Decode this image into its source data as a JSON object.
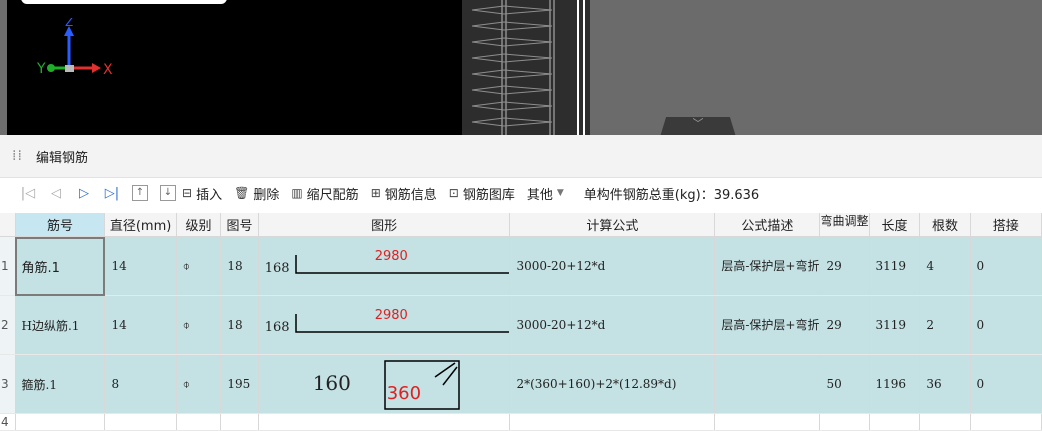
{
  "viewport": {
    "axis": {
      "z": "Z",
      "y": "Y",
      "x": "X"
    },
    "handle_glyph": "﹀"
  },
  "panel": {
    "title": "编辑钢筋",
    "grip_glyph": "⁞⁞"
  },
  "toolbar": {
    "nav_first": "|◁",
    "nav_prev": "◁",
    "nav_next": "▷",
    "nav_last": "▷|",
    "move_up": "↑",
    "move_down": "↓",
    "insert": "插入",
    "delete": "删除",
    "scale": "缩尺配筋",
    "info": "钢筋信息",
    "library": "钢筋图库",
    "other": "其他",
    "total_label": "单构件钢筋总重(kg)：39.636"
  },
  "columns": [
    "筋号",
    "直径(mm)",
    "级别",
    "图号",
    "图形",
    "计算公式",
    "公式描述",
    "弯曲调整",
    "长度",
    "根数",
    "搭接"
  ],
  "rows": [
    {
      "num": "1",
      "name": "角筋.1",
      "dia": "14",
      "grade": "⌽",
      "fig": "18",
      "shape_left": "168",
      "shape_top": "2980",
      "shape_type": "L",
      "formula": "3000-20+12*d",
      "desc": "层高-保护层+弯折",
      "bend": "29",
      "length": "3119",
      "count": "4",
      "lap": "0"
    },
    {
      "num": "2",
      "name": "H边纵筋.1",
      "dia": "14",
      "grade": "⌽",
      "fig": "18",
      "shape_left": "168",
      "shape_top": "2980",
      "shape_type": "L",
      "formula": "3000-20+12*d",
      "desc": "层高-保护层+弯折",
      "bend": "29",
      "length": "3119",
      "count": "2",
      "lap": "0"
    },
    {
      "num": "3",
      "name": "箍筋.1",
      "dia": "8",
      "grade": "⌽",
      "fig": "195",
      "shape_left": "160",
      "shape_top": "360",
      "shape_type": "stirrup",
      "formula": "2*(360+160)+2*(12.89*d)",
      "desc": "",
      "bend": "50",
      "length": "1196",
      "count": "36",
      "lap": "0"
    }
  ],
  "empty_row_num": "4",
  "colors": {
    "row_bg": "#c4e1e4",
    "shape_red": "#e02020"
  }
}
